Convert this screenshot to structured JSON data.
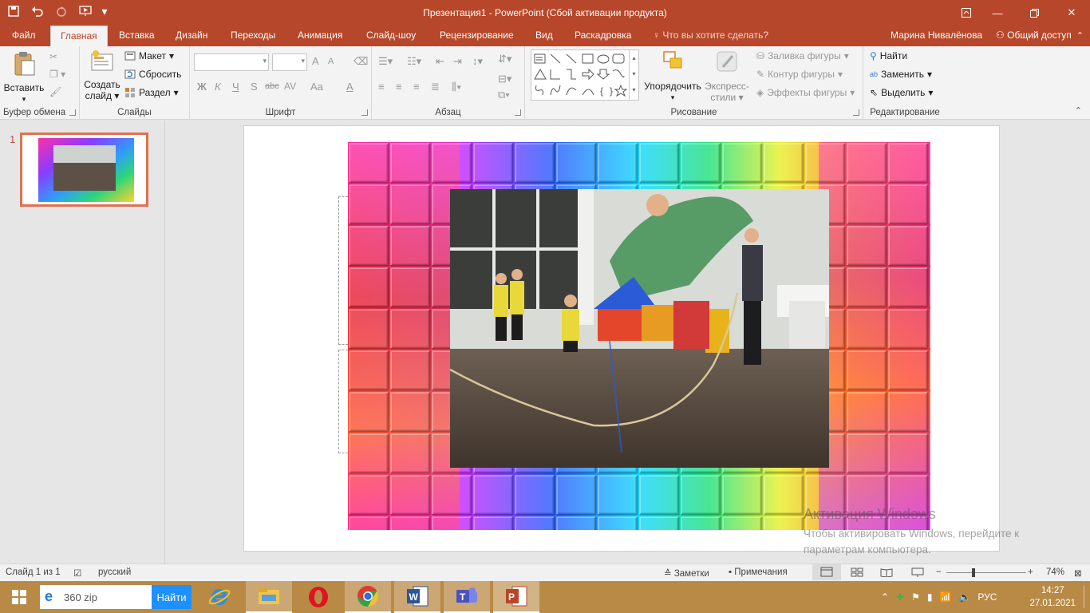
{
  "window": {
    "title": "Презентация1 - PowerPoint (Сбой активации продукта)"
  },
  "tabs": {
    "file": "Файл",
    "home": "Главная",
    "insert": "Вставка",
    "design": "Дизайн",
    "transitions": "Переходы",
    "animations": "Анимация",
    "slideshow": "Слайд-шоу",
    "review": "Рецензирование",
    "view": "Вид",
    "storyboard": "Раскадровка",
    "tell_me": "Что вы хотите сделать?",
    "user": "Марина Нивалёнова",
    "share": "Общий доступ"
  },
  "ribbon": {
    "clipboard": {
      "paste": "Вставить",
      "label": "Буфер обмена"
    },
    "slides": {
      "new_slide": "Создать",
      "new_slide_2": "слайд",
      "layout": "Макет",
      "reset": "Сбросить",
      "section": "Раздел",
      "label": "Слайды"
    },
    "font": {
      "label": "Шрифт",
      "bold": "Ж",
      "italic": "К",
      "underline": "Ч",
      "shadow": "S",
      "strike": "abc",
      "spacing": "AV",
      "case": "Aa",
      "color": "A",
      "grow": "A",
      "shrink": "A"
    },
    "paragraph": {
      "label": "Абзац"
    },
    "drawing": {
      "arrange": "Упорядочить",
      "quick_styles": "Экспресс-",
      "quick_styles_2": "стили",
      "fill": "Заливка фигуры",
      "outline": "Контур фигуры",
      "effects": "Эффекты фигуры",
      "label": "Рисование"
    },
    "editing": {
      "find": "Найти",
      "replace": "Заменить",
      "select": "Выделить",
      "label": "Редактирование"
    }
  },
  "thumbnails": {
    "number": "1"
  },
  "activation": {
    "line1": "Активация Windows",
    "line2": "Чтобы активировать Windows, перейдите к",
    "line3": "параметрам компьютера."
  },
  "statusbar": {
    "slide_info": "Слайд 1 из 1",
    "language": "русский",
    "notes": "Заметки",
    "comments": "Примечания",
    "zoom": "74%",
    "zoom_minus": "−",
    "zoom_plus": "+"
  },
  "taskbar": {
    "search_text": "360 zip",
    "search_button": "Найти",
    "lang": "РУС",
    "time": "14:27",
    "date": "27.01.2021"
  },
  "colors": {
    "accent": "#b7472a",
    "taskbar": "#b88a46"
  }
}
